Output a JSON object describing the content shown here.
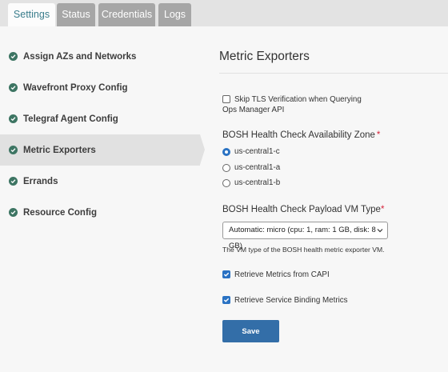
{
  "tabs": [
    {
      "label": "Settings",
      "active": true
    },
    {
      "label": "Status",
      "active": false
    },
    {
      "label": "Credentials",
      "active": false
    },
    {
      "label": "Logs",
      "active": false
    }
  ],
  "sidebar": {
    "items": [
      {
        "label": "Assign AZs and Networks",
        "icon": "check-circle-icon"
      },
      {
        "label": "Wavefront Proxy Config",
        "icon": "check-circle-icon"
      },
      {
        "label": "Telegraf Agent Config",
        "icon": "check-circle-icon"
      },
      {
        "label": "Metric Exporters",
        "icon": "check-circle-icon",
        "selected": true
      },
      {
        "label": "Errands",
        "icon": "check-circle-icon"
      },
      {
        "label": "Resource Config",
        "icon": "check-circle-icon"
      }
    ]
  },
  "main": {
    "title": "Metric Exporters",
    "skip_tls": {
      "line1": "Skip TLS Verification when Querying",
      "line2": "Ops Manager API",
      "checked": false
    },
    "az": {
      "label": "BOSH Health Check Availability Zone",
      "required_mark": "*",
      "options": [
        {
          "label": "us-central1-c",
          "selected": true
        },
        {
          "label": "us-central1-a",
          "selected": false
        },
        {
          "label": "us-central1-b",
          "selected": false
        }
      ]
    },
    "vm_type": {
      "label": "BOSH Health Check Payload VM Type",
      "required_mark": "*",
      "value": "Automatic: micro (cpu: 1, ram: 1 GB, disk: 8 GB)",
      "hint": "The VM type of the BOSH health metric exporter VM."
    },
    "capi": {
      "label": "Retrieve Metrics from CAPI",
      "checked": true
    },
    "service_binding": {
      "label": "Retrieve Service Binding Metrics",
      "checked": true
    },
    "save_label": "Save"
  },
  "colors": {
    "accent": "#336ea8",
    "check_green": "#3d7563",
    "required_red": "#d6253c",
    "active_tab_text": "#3a7d8c"
  }
}
